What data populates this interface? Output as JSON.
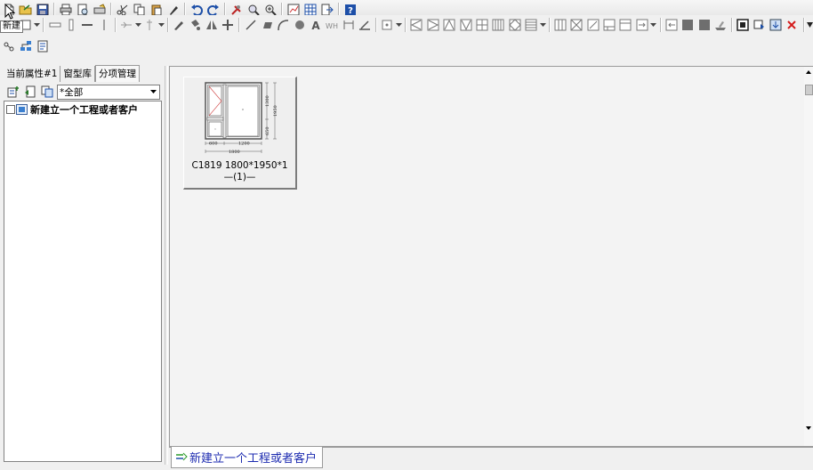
{
  "tooltip": "新建",
  "left_panel": {
    "tabs": [
      {
        "label": "当前属性#1",
        "active": false
      },
      {
        "label": "窗型库",
        "active": false
      },
      {
        "label": "分项管理",
        "active": true
      }
    ],
    "filter": {
      "selected": "*全部"
    },
    "tree": {
      "root_label": "新建立一个工程或者客户"
    }
  },
  "window_card": {
    "title": "C1819 1800*1950*1",
    "quantity": "—(1)—",
    "dims": {
      "width_total": "1800",
      "width_left": "600",
      "width_right": "1200",
      "height_total": "1950",
      "height_top": "1300",
      "height_bottom": "650"
    }
  },
  "bottom_tab": {
    "label": "新建立一个工程或者客户"
  },
  "colors": {
    "accent_text": "#1c2bb0",
    "close_red": "#d41a1a",
    "help_blue": "#1d4fa8"
  },
  "toolbar": {
    "row1_icons": [
      "new-icon",
      "open-icon",
      "save-icon",
      "print-icon",
      "print-preview-icon",
      "print-setup-icon",
      "cut-icon",
      "copy-icon",
      "paste-icon",
      "brush-icon",
      "undo-icon",
      "redo-icon",
      "tools-icon",
      "zoom-icon",
      "zoom-fit-icon",
      "report-icon",
      "table-icon",
      "export-icon",
      "help-icon"
    ],
    "row2_icons": [
      "frame-icon",
      "horizontal-bar-icon",
      "vertical-bar-icon",
      "divide-h-icon",
      "divide-v-icon",
      "sash-icon",
      "angle-icon",
      "mirror-icon",
      "move-icon",
      "line-icon",
      "rect-icon",
      "arc-icon",
      "circle-icon",
      "text-icon",
      "wh-icon",
      "dim-icon",
      "measure-icon",
      "shape-icon",
      "triangle-left-icon",
      "triangle-right-icon",
      "triangle-up-icon",
      "triangle-down-icon",
      "grid-icon",
      "grid4-icon",
      "stack-icon",
      "panel-icon",
      "cross-panel-icon",
      "diamond-panel-icon",
      "x-panel-icon",
      "door-icon",
      "arrow-right-icon",
      "arrow-left-icon",
      "fill-icon",
      "fill-dark-icon",
      "settings-icon",
      "frame2-icon",
      "refresh-icon",
      "download-icon",
      "close-icon"
    ]
  }
}
